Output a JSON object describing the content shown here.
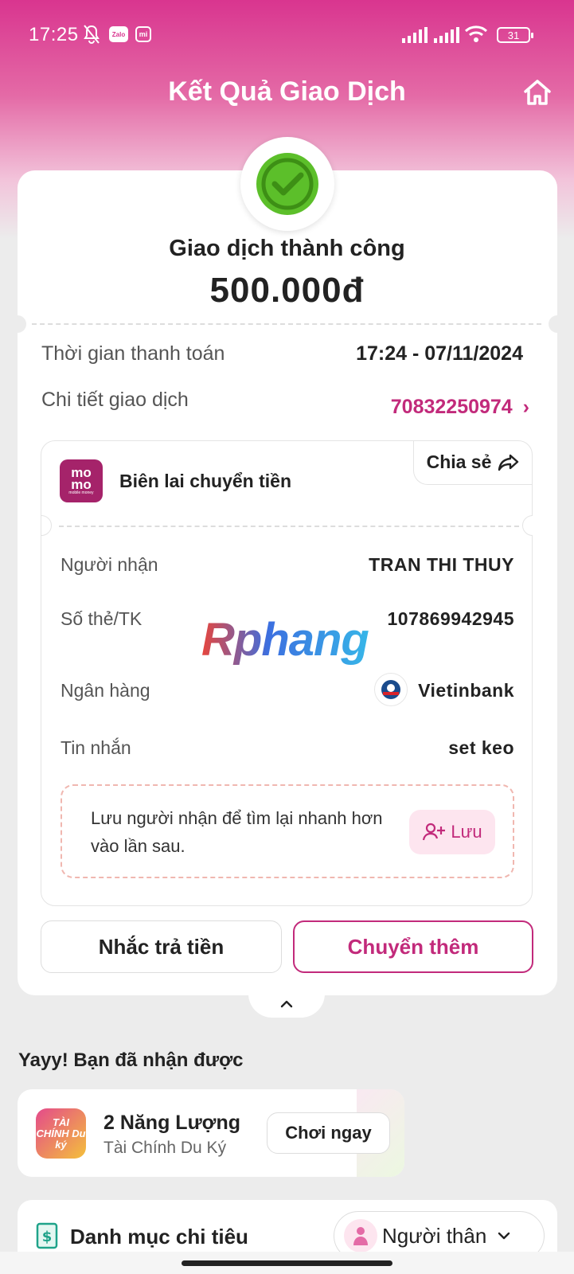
{
  "status_bar": {
    "time": "17:25",
    "zalo_label": "Zalo",
    "mi_label": "mi",
    "battery": "31"
  },
  "header": {
    "title": "Kết Quả Giao Dịch"
  },
  "result": {
    "status": "Giao dịch thành công",
    "amount": "500.000đ"
  },
  "info": {
    "time_label": "Thời gian thanh toán",
    "time_value": "17:24 - 07/11/2024",
    "detail_label": "Chi tiết giao dịch",
    "detail_value": "70832250974"
  },
  "receipt": {
    "logo_text_1": "mo",
    "logo_text_2": "mo",
    "logo_sub": "mobile money",
    "title": "Biên lai chuyển tiền",
    "share_label": "Chia sẻ",
    "recipient_label": "Người nhận",
    "recipient_value": "TRAN THI THUY",
    "account_label": "Số thẻ/TK",
    "account_value": "107869942945",
    "bank_label": "Ngân hàng",
    "bank_value": "Vietinbank",
    "message_label": "Tin nhắn",
    "message_value": "set keo",
    "save_text": "Lưu người nhận để tìm lại nhanh hơn vào lần sau.",
    "save_button": "Lưu"
  },
  "watermark": "Rphang",
  "actions": {
    "remind_label": "Nhắc trả tiền",
    "transfer_more_label": "Chuyển thêm"
  },
  "reward": {
    "heading": "Yayy! Bạn đã nhận được",
    "logo_text": "TÀI CHÍNH Du ký",
    "title": "2 Năng Lượng",
    "subtitle": "Tài Chính Du Ký",
    "play_label": "Chơi ngay"
  },
  "category": {
    "title": "Danh mục chi tiêu",
    "selected": "Người thân"
  },
  "colors": {
    "brand": "#c22a7b",
    "header_top": "#d9358f",
    "success_green": "#5cbf2a"
  }
}
